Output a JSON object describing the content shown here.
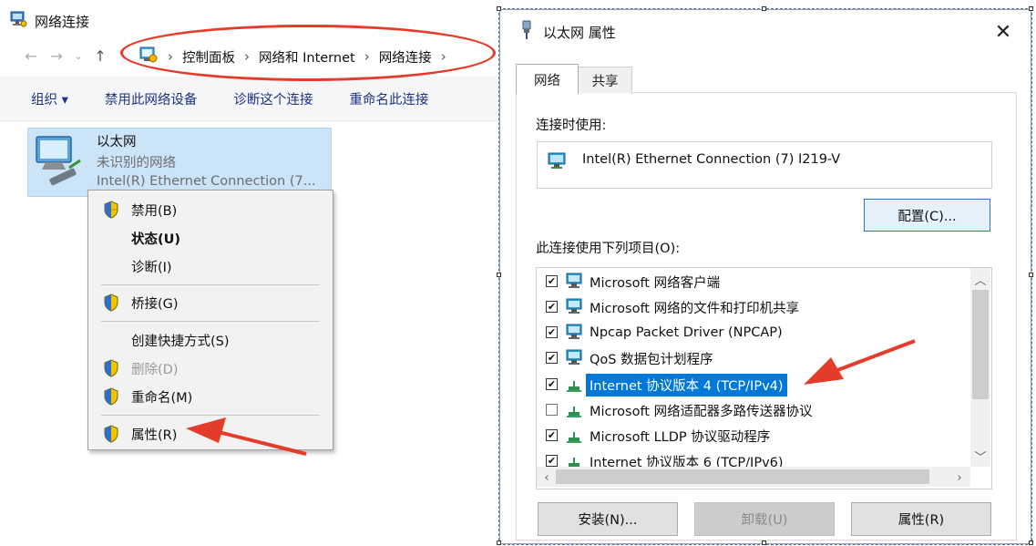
{
  "explorer": {
    "title": "网络连接",
    "breadcrumb": [
      "控制面板",
      "网络和 Internet",
      "网络连接"
    ],
    "breadcrumb_sep": "›",
    "toolbar": {
      "organize": "组织 ▾",
      "disable": "禁用此网络设备",
      "diagnose": "诊断这个连接",
      "rename": "重命名此连接"
    },
    "adapter": {
      "name": "以太网",
      "status": "未识别的网络",
      "device": "Intel(R) Ethernet Connection (7..."
    },
    "context_menu": [
      {
        "label": "禁用(B)",
        "icon": "shield-icon"
      },
      {
        "label": "状态(U)",
        "bold": true
      },
      {
        "label": "诊断(I)"
      },
      {
        "label": "桥接(G)",
        "icon": "shield-icon"
      },
      {
        "label": "创建快捷方式(S)"
      },
      {
        "label": "删除(D)",
        "icon": "shield-icon",
        "disabled": true
      },
      {
        "label": "重命名(M)",
        "icon": "shield-icon"
      },
      {
        "label": "属性(R)",
        "icon": "shield-icon"
      }
    ]
  },
  "dialog": {
    "title": "以太网 属性",
    "close": "✕",
    "tabs": [
      "网络",
      "共享"
    ],
    "active_tab": "网络",
    "connect_using_label": "连接时使用:",
    "device": "Intel(R) Ethernet Connection (7) I219-V",
    "configure_button": "配置(C)...",
    "items_label": "此连接使用下列项目(O):",
    "items": [
      {
        "label": "Microsoft 网络客户端",
        "checked": true,
        "icon": "network-client-icon"
      },
      {
        "label": "Microsoft 网络的文件和打印机共享",
        "checked": true,
        "icon": "network-client-icon"
      },
      {
        "label": "Npcap Packet Driver (NPCAP)",
        "checked": true,
        "icon": "network-client-icon"
      },
      {
        "label": "QoS 数据包计划程序",
        "checked": true,
        "icon": "network-client-icon"
      },
      {
        "label": "Internet 协议版本 4 (TCP/IPv4)",
        "checked": true,
        "icon": "protocol-icon",
        "selected": true
      },
      {
        "label": "Microsoft 网络适配器多路传送器协议",
        "checked": false,
        "icon": "protocol-icon"
      },
      {
        "label": "Microsoft LLDP 协议驱动程序",
        "checked": true,
        "icon": "protocol-icon"
      },
      {
        "label": "Internet 协议版本 6 (TCP/IPv6)",
        "checked": true,
        "icon": "protocol-icon"
      }
    ],
    "buttons": {
      "install": "安装(N)...",
      "uninstall": "卸载(U)",
      "properties": "属性(R)"
    }
  },
  "colors": {
    "annotation_red": "#e53b2b",
    "selection_blue": "#0078d7",
    "toolbar_link": "#1e3287",
    "adapter_highlight": "#cce4f7"
  }
}
